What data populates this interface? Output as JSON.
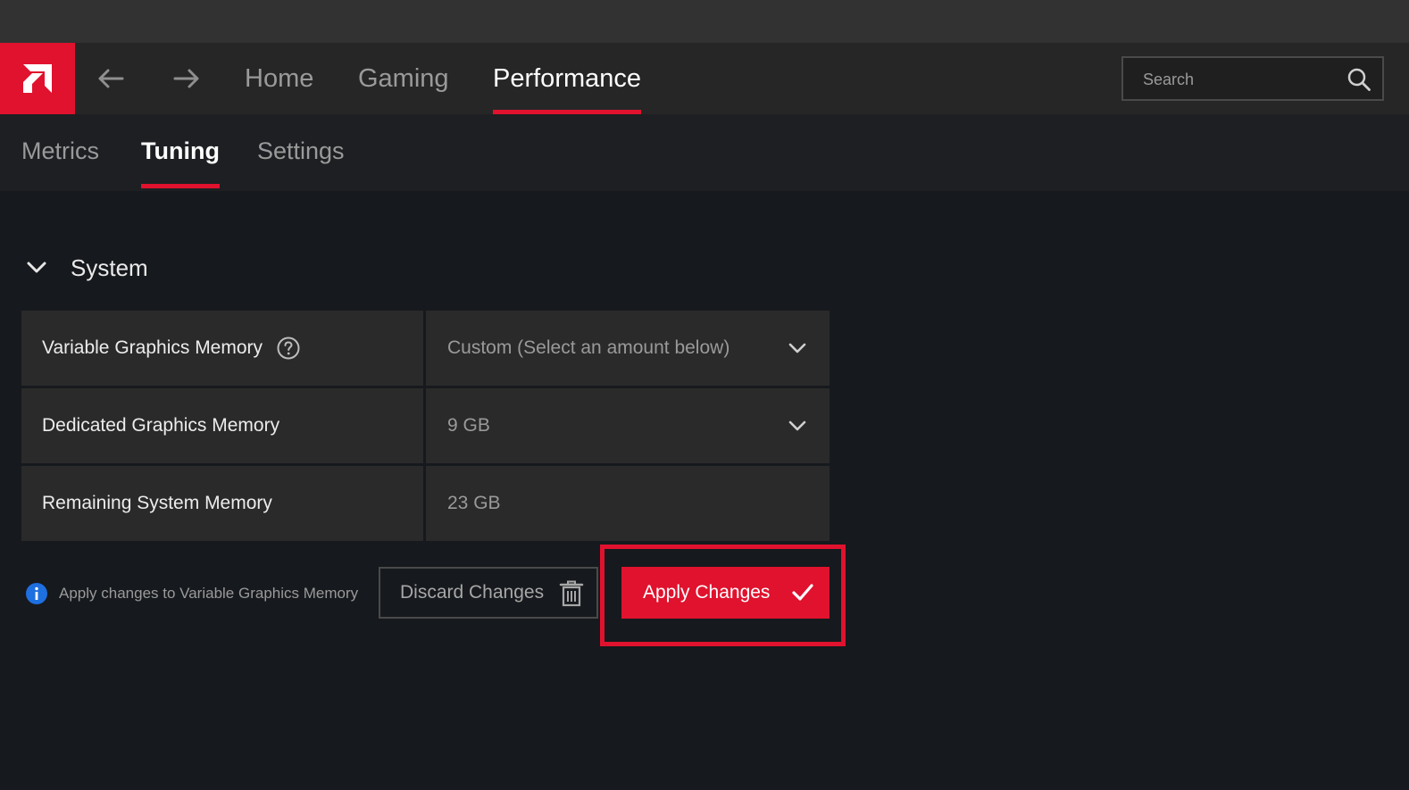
{
  "nav": {
    "logo_icon": "amd-logo-icon",
    "back_icon": "arrow-left-icon",
    "forward_icon": "arrow-right-icon",
    "tabs": [
      {
        "label": "Home",
        "active": false
      },
      {
        "label": "Gaming",
        "active": false
      },
      {
        "label": "Performance",
        "active": true
      }
    ],
    "search": {
      "placeholder": "Search",
      "value": "",
      "icon": "search-icon"
    }
  },
  "subnav": {
    "tabs": [
      {
        "label": "Metrics",
        "active": false
      },
      {
        "label": "Tuning",
        "active": true
      },
      {
        "label": "Settings",
        "active": false
      }
    ]
  },
  "section": {
    "title": "System",
    "expanded": true,
    "rows": [
      {
        "label": "Variable Graphics Memory",
        "value": "Custom (Select an amount below)",
        "has_help": true,
        "dropdown": true
      },
      {
        "label": "Dedicated Graphics Memory",
        "value": "9 GB",
        "has_help": false,
        "dropdown": true
      },
      {
        "label": "Remaining System Memory",
        "value": "23 GB",
        "has_help": false,
        "dropdown": false
      }
    ]
  },
  "footer": {
    "note": "Apply changes to Variable Graphics Memory",
    "discard_label": "Discard Changes",
    "apply_label": "Apply Changes"
  },
  "colors": {
    "accent": "#e0122e",
    "info_blue": "#1e6fe0",
    "background": "#16191d"
  }
}
